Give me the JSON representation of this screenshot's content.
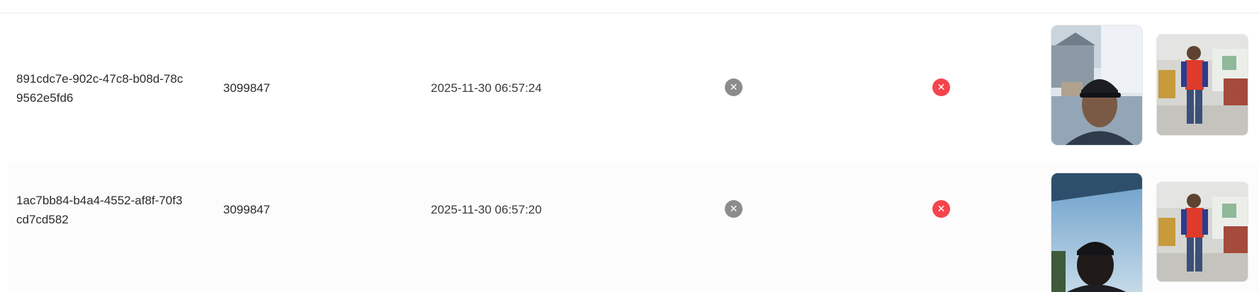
{
  "table": {
    "rows": [
      {
        "id": "891cdc7e-902c-47c8-b08d-78c9562e5fd6",
        "user_id": "3099847",
        "timestamp": "2025-11-30 06:57:24",
        "status_a_icon": "close-circle-gray-icon",
        "status_b_icon": "close-circle-red-icon",
        "photo_capture": "face-capture-photo",
        "photo_reference": "reference-full-body-photo"
      },
      {
        "id": "1ac7bb84-b4a4-4552-af8f-70f3cd7cd582",
        "user_id": "3099847",
        "timestamp": "2025-11-30 06:57:20",
        "status_a_icon": "close-circle-gray-icon",
        "status_b_icon": "close-circle-red-icon",
        "photo_capture": "face-capture-photo",
        "photo_reference": "reference-full-body-photo"
      }
    ]
  },
  "colors": {
    "status_gray": "#8c8c8c",
    "status_red": "#f5444c"
  }
}
